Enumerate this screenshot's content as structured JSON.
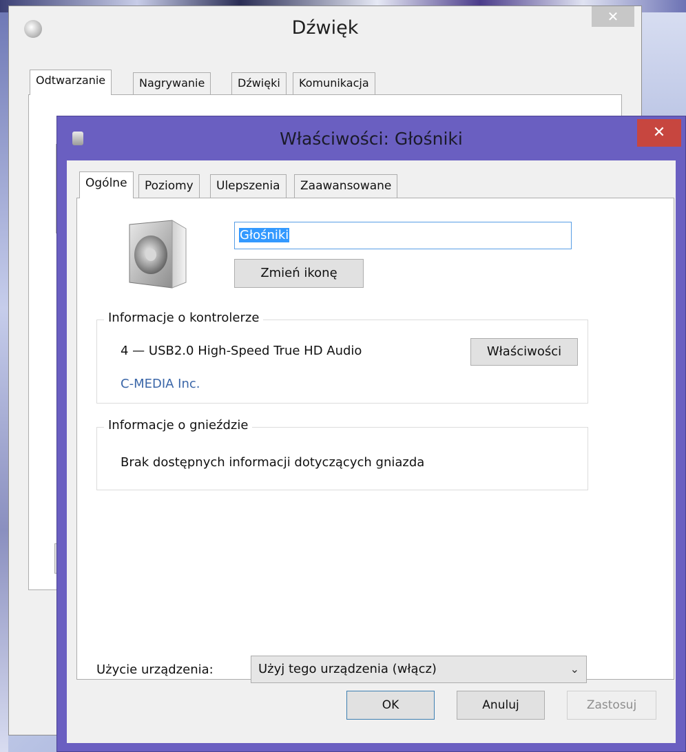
{
  "back_window": {
    "title": "Dźwięk",
    "close_label": "✕",
    "tabs": [
      {
        "label": "Odtwarzanie"
      },
      {
        "label": "Nagrywanie"
      },
      {
        "label": "Dźwięki"
      },
      {
        "label": "Komunikacja"
      }
    ],
    "active_tab": "Odtwarzanie"
  },
  "front_window": {
    "title": "Właściwości: Głośniki",
    "close_label": "✕",
    "tabs": [
      {
        "label": "Ogólne"
      },
      {
        "label": "Poziomy"
      },
      {
        "label": "Ulepszenia"
      },
      {
        "label": "Zaawansowane"
      }
    ],
    "active_tab": "Ogólne",
    "device_name": "Głośniki",
    "change_icon_label": "Zmień ikonę",
    "controller_group": {
      "legend": "Informacje o kontrolerze",
      "name": "4 — USB2.0 High-Speed True HD Audio",
      "vendor": "C-MEDIA Inc.",
      "properties_label": "Właściwości"
    },
    "jack_group": {
      "legend": "Informacje o gnieździe",
      "message": "Brak dostępnych informacji dotyczących gniazda"
    },
    "usage": {
      "label": "Użycie urządzenia:",
      "selected": "Użyj tego urządzenia (włącz)",
      "chevron": "⌄"
    },
    "buttons": {
      "ok": "OK",
      "cancel": "Anuluj",
      "apply": "Zastosuj"
    }
  },
  "colors": {
    "front_frame": "#6a5fc1",
    "close_red": "#c7463f",
    "vendor_link": "#3a66a8",
    "selection": "#3399ff"
  }
}
